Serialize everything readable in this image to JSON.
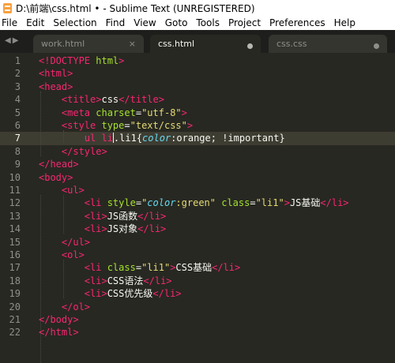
{
  "window": {
    "title": "D:\\前端\\css.html • - Sublime Text (UNREGISTERED)"
  },
  "menu": [
    "File",
    "Edit",
    "Selection",
    "Find",
    "View",
    "Goto",
    "Tools",
    "Project",
    "Preferences",
    "Help"
  ],
  "tabs": [
    {
      "label": "work.html",
      "control": "×",
      "active": false
    },
    {
      "label": "css.html",
      "control": "dot",
      "active": true
    },
    {
      "label": "css.css",
      "control": "dot",
      "active": false
    }
  ],
  "nav_arrows": "◀▶",
  "editor": {
    "current_line": 7,
    "lines": [
      {
        "n": "1",
        "t": [
          [
            "tg",
            "<!DOCTYPE "
          ],
          [
            "at",
            "html"
          ],
          [
            "tg",
            ">"
          ]
        ]
      },
      {
        "n": "2",
        "t": [
          [
            "tg",
            "<html>"
          ]
        ]
      },
      {
        "n": "3",
        "t": [
          [
            "tg",
            "<head>"
          ]
        ]
      },
      {
        "n": "4",
        "t": [
          [
            "pl",
            "    "
          ],
          [
            "tg",
            "<title>"
          ],
          [
            "pl",
            "css"
          ],
          [
            "tg",
            "</title>"
          ]
        ]
      },
      {
        "n": "5",
        "t": [
          [
            "pl",
            "    "
          ],
          [
            "tg",
            "<meta "
          ],
          [
            "at",
            "charset"
          ],
          [
            "pl",
            "="
          ],
          [
            "st",
            "\"utf-8\""
          ],
          [
            "tg",
            ">"
          ]
        ]
      },
      {
        "n": "6",
        "t": [
          [
            "pl",
            "    "
          ],
          [
            "tg",
            "<style "
          ],
          [
            "at",
            "type"
          ],
          [
            "pl",
            "="
          ],
          [
            "st",
            "\"text/css\""
          ],
          [
            "tg",
            ">"
          ]
        ]
      },
      {
        "n": "7",
        "t": [
          [
            "pl",
            "        "
          ],
          [
            "tg",
            "ul li"
          ],
          [
            "cur",
            ""
          ],
          [
            "pl",
            ".li1{"
          ],
          [
            "pr",
            "color"
          ],
          [
            "pl",
            ":orange; !important}"
          ]
        ]
      },
      {
        "n": "8",
        "t": [
          [
            "pl",
            "    "
          ],
          [
            "tg",
            "</style>"
          ]
        ]
      },
      {
        "n": "9",
        "t": [
          [
            "tg",
            "</head>"
          ]
        ]
      },
      {
        "n": "10",
        "t": [
          [
            "tg",
            "<body>"
          ]
        ]
      },
      {
        "n": "11",
        "t": [
          [
            "pl",
            "    "
          ],
          [
            "tg",
            "<ul>"
          ]
        ]
      },
      {
        "n": "12",
        "t": [
          [
            "pl",
            "        "
          ],
          [
            "tg",
            "<li "
          ],
          [
            "at",
            "style"
          ],
          [
            "pl",
            "="
          ],
          [
            "st",
            "\""
          ],
          [
            "pr",
            "color"
          ],
          [
            "st",
            ":green\" "
          ],
          [
            "at",
            "class"
          ],
          [
            "pl",
            "="
          ],
          [
            "st",
            "\"li1\""
          ],
          [
            "tg",
            ">"
          ],
          [
            "pl",
            "JS基础"
          ],
          [
            "tg",
            "</li>"
          ]
        ]
      },
      {
        "n": "13",
        "t": [
          [
            "pl",
            "        "
          ],
          [
            "tg",
            "<li>"
          ],
          [
            "pl",
            "JS函数"
          ],
          [
            "tg",
            "</li>"
          ]
        ]
      },
      {
        "n": "14",
        "t": [
          [
            "pl",
            "        "
          ],
          [
            "tg",
            "<li>"
          ],
          [
            "pl",
            "JS对象"
          ],
          [
            "tg",
            "</li>"
          ]
        ]
      },
      {
        "n": "15",
        "t": [
          [
            "pl",
            "    "
          ],
          [
            "tg",
            "</ul>"
          ]
        ]
      },
      {
        "n": "16",
        "t": [
          [
            "pl",
            "    "
          ],
          [
            "tg",
            "<ol>"
          ]
        ]
      },
      {
        "n": "17",
        "t": [
          [
            "pl",
            "        "
          ],
          [
            "tg",
            "<li "
          ],
          [
            "at",
            "class"
          ],
          [
            "pl",
            "="
          ],
          [
            "st",
            "\"li1\""
          ],
          [
            "tg",
            ">"
          ],
          [
            "pl",
            "CSS基础"
          ],
          [
            "tg",
            "</li>"
          ]
        ]
      },
      {
        "n": "18",
        "t": [
          [
            "pl",
            "        "
          ],
          [
            "tg",
            "<li>"
          ],
          [
            "pl",
            "CSS语法"
          ],
          [
            "tg",
            "</li>"
          ]
        ]
      },
      {
        "n": "19",
        "t": [
          [
            "pl",
            "        "
          ],
          [
            "tg",
            "<li>"
          ],
          [
            "pl",
            "CSS优先级"
          ],
          [
            "tg",
            "</li>"
          ]
        ]
      },
      {
        "n": "20",
        "t": [
          [
            "pl",
            "    "
          ],
          [
            "tg",
            "</ol>"
          ]
        ]
      },
      {
        "n": "21",
        "t": [
          [
            "tg",
            "</body>"
          ]
        ]
      },
      {
        "n": "22",
        "t": [
          [
            "tg",
            "</html>"
          ]
        ]
      }
    ]
  }
}
